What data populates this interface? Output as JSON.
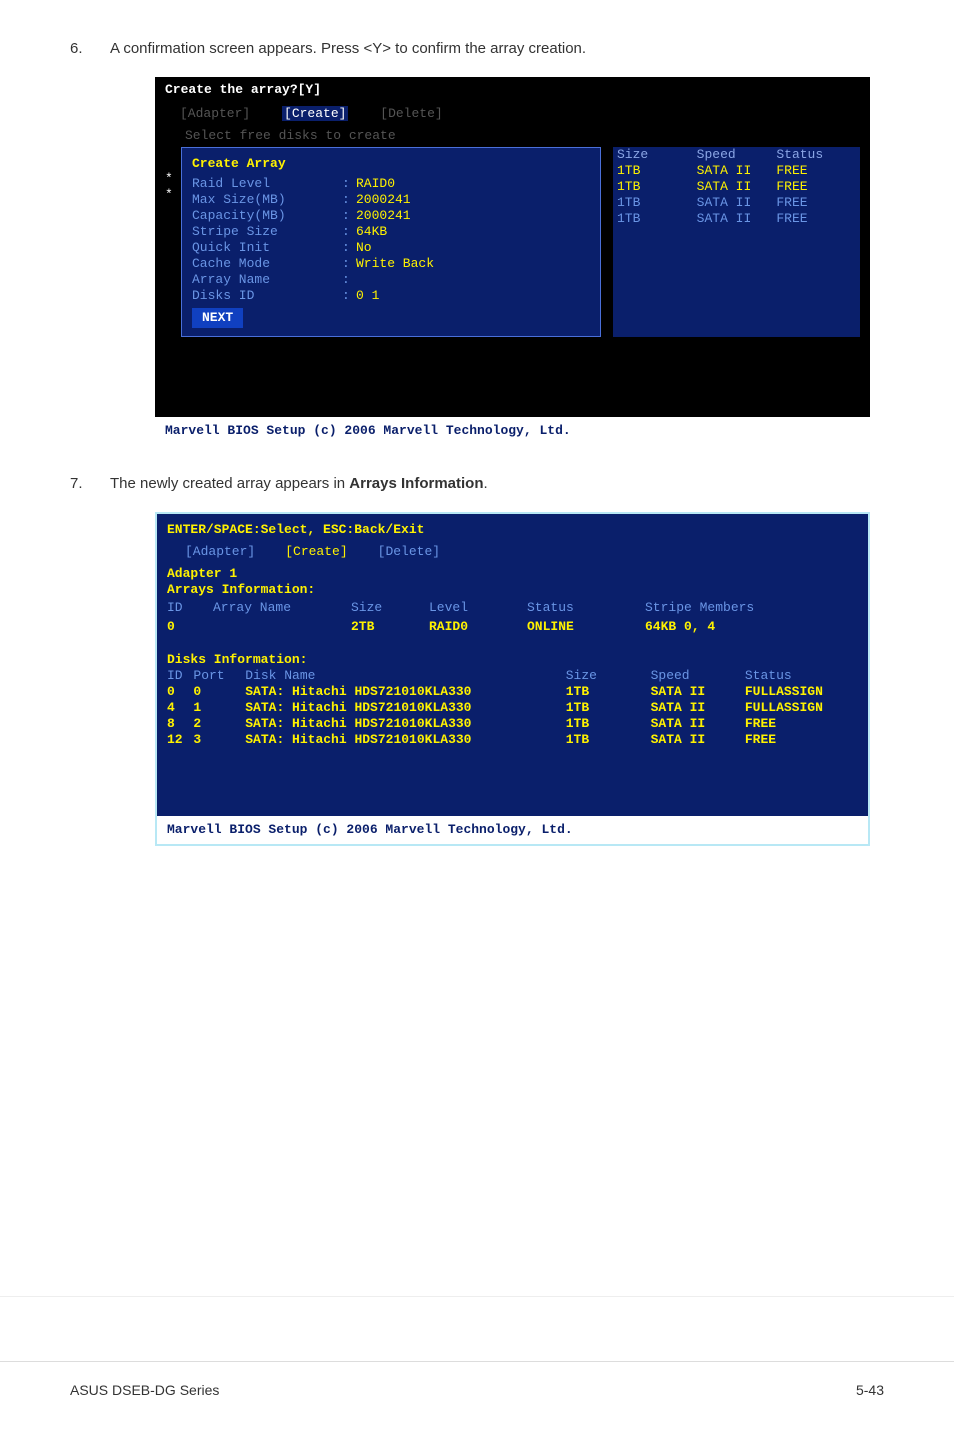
{
  "step6": {
    "num": "6.",
    "text": "A confirmation screen appears. Press <Y> to confirm the array creation."
  },
  "step7": {
    "num": "7.",
    "text": "The newly created array appears in Arrays Information."
  },
  "bios1": {
    "prompt": "Create the array?[Y]",
    "tabs": {
      "adapter": "[Adapter]",
      "create": "[Create]",
      "delete": "[Delete]"
    },
    "selectLine": "Select free disks to create",
    "panelTitle": "Create Array",
    "fields": [
      {
        "k": "Raid Level",
        "sep": ":",
        "v": "RAID0",
        "star": "*"
      },
      {
        "k": "Max Size(MB)",
        "sep": ":",
        "v": "2000241",
        "star": "*"
      },
      {
        "k": "Capacity(MB)",
        "sep": ":",
        "v": "2000241",
        "star": ""
      },
      {
        "k": "Stripe Size",
        "sep": ":",
        "v": "64KB",
        "star": ""
      },
      {
        "k": "Quick Init",
        "sep": ":",
        "v": "No",
        "star": ""
      },
      {
        "k": "Cache Mode",
        "sep": ":",
        "v": "Write Back",
        "star": ""
      },
      {
        "k": "Array Name",
        "sep": ":",
        "v": "",
        "star": ""
      },
      {
        "k": "Disks ID",
        "sep": ":",
        "v": "0 1",
        "star": ""
      }
    ],
    "next": "NEXT",
    "diskHead": {
      "size": "Size",
      "speed": "Speed",
      "status": "Status"
    },
    "disks": [
      {
        "size": "1TB",
        "speed": "SATA II",
        "status": "FREE",
        "bright": true
      },
      {
        "size": "1TB",
        "speed": "SATA II",
        "status": "FREE",
        "bright": true
      },
      {
        "size": "1TB",
        "speed": "SATA II",
        "status": "FREE",
        "bright": false
      },
      {
        "size": "1TB",
        "speed": "SATA II",
        "status": "FREE",
        "bright": false
      }
    ],
    "footer": "Marvell BIOS Setup (c) 2006 Marvell Technology, Ltd."
  },
  "bios2": {
    "helpLine": "ENTER/SPACE:Select, ESC:Back/Exit",
    "tabs": {
      "adapter": "[Adapter]",
      "create": "[Create]",
      "delete": "[Delete]"
    },
    "adapter": "Adapter 1",
    "arraysTitle": "Arrays Information:",
    "arrayHead": {
      "id": "ID",
      "name": "Array Name",
      "size": "Size",
      "level": "Level",
      "status": "Status",
      "stripe": "Stripe Members"
    },
    "arrayRow": {
      "id": "0",
      "name": "",
      "size": "2TB",
      "level": "RAID0",
      "status": "ONLINE",
      "stripe": "64KB  0, 4"
    },
    "disksTitle": "Disks Information:",
    "diskHead": {
      "id": "ID",
      "port": "Port",
      "name": "Disk Name",
      "size": "Size",
      "speed": "Speed",
      "status": "Status"
    },
    "disks": [
      {
        "id": "0",
        "port": "0",
        "name": "SATA: Hitachi HDS721010KLA330",
        "size": "1TB",
        "speed": "SATA II",
        "status": "FULLASSIGN"
      },
      {
        "id": "4",
        "port": "1",
        "name": "SATA: Hitachi HDS721010KLA330",
        "size": "1TB",
        "speed": "SATA II",
        "status": "FULLASSIGN"
      },
      {
        "id": "8",
        "port": "2",
        "name": "SATA: Hitachi HDS721010KLA330",
        "size": "1TB",
        "speed": "SATA II",
        "status": "FREE"
      },
      {
        "id": "12",
        "port": "3",
        "name": "SATA: Hitachi HDS721010KLA330",
        "size": "1TB",
        "speed": "SATA II",
        "status": "FREE"
      }
    ],
    "footer": "Marvell BIOS Setup (c) 2006 Marvell Technology, Ltd."
  },
  "pageFooter": {
    "left": "ASUS DSEB-DG Series",
    "right": "5-43"
  }
}
